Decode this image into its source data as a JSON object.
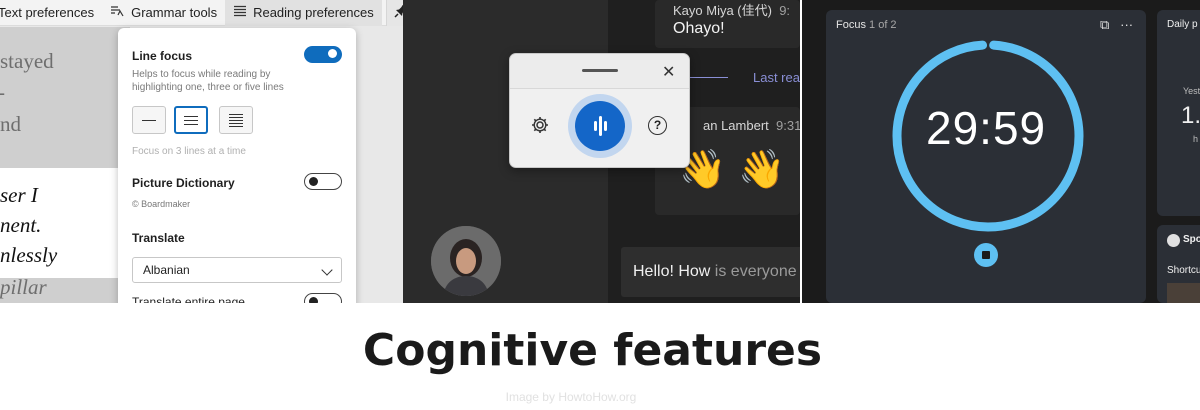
{
  "reader": {
    "toolbar": {
      "text_prefs": "Text preferences",
      "grammar": "Grammar tools",
      "reading": "Reading preferences"
    },
    "text_lines": [
      "stayed",
      "-",
      "nd",
      "ser I",
      "nent.",
      "nlessly",
      "pillar"
    ],
    "line_focus": {
      "title": "Line focus",
      "enabled": true,
      "desc": "Helps to focus while reading by highlighting one, three or five lines",
      "hint": "Focus on 3 lines at a time",
      "selected_option": 3
    },
    "picture_dictionary": {
      "title": "Picture Dictionary",
      "enabled": false,
      "credit": "© Boardmaker"
    },
    "translate": {
      "title": "Translate",
      "language": "Albanian",
      "entire_page_label": "Translate entire page",
      "entire_page_enabled": false
    }
  },
  "chat": {
    "sender1": "Kayo Miya (佳代)",
    "sender1_time": "9:",
    "message1": "Ohayo!",
    "last_read": "Last rea",
    "sender2": "an Lambert",
    "sender2_time": "9:31 A",
    "emojis": [
      "👋",
      "👋"
    ],
    "compose_typed": "Hello! How",
    "compose_suggest": " is everyone"
  },
  "voice_typing": {
    "close_glyph": "✕",
    "help_glyph": "?"
  },
  "focus": {
    "title": "Focus",
    "page": "1 of 2",
    "timer": "29:59",
    "progress": 0.98,
    "accent_color": "#5ec0f2",
    "side": {
      "daily_title": "Daily p",
      "yesterday": "Yeste",
      "big_value": "1.",
      "unit": "h",
      "spotify": "Spo",
      "shortcuts": "Shortcu"
    }
  },
  "caption": "Cognitive features",
  "credit": "Image by HowtoHow.org"
}
